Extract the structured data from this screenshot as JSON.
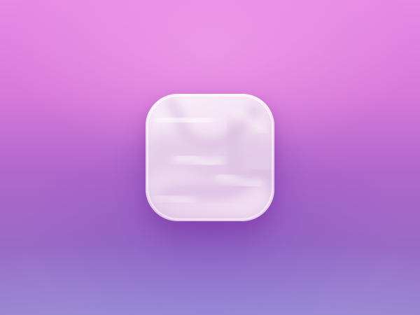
{
  "background": {
    "top_color": "#e78ae6",
    "mid_color": "#b067cc",
    "bottom_color": "#9b86d0"
  },
  "icon": {
    "name": "glossy-squircle-app-icon",
    "base_color": "#f3e4f3",
    "highlight_color": "#ffffff",
    "shade_color": "#d9b9de"
  }
}
